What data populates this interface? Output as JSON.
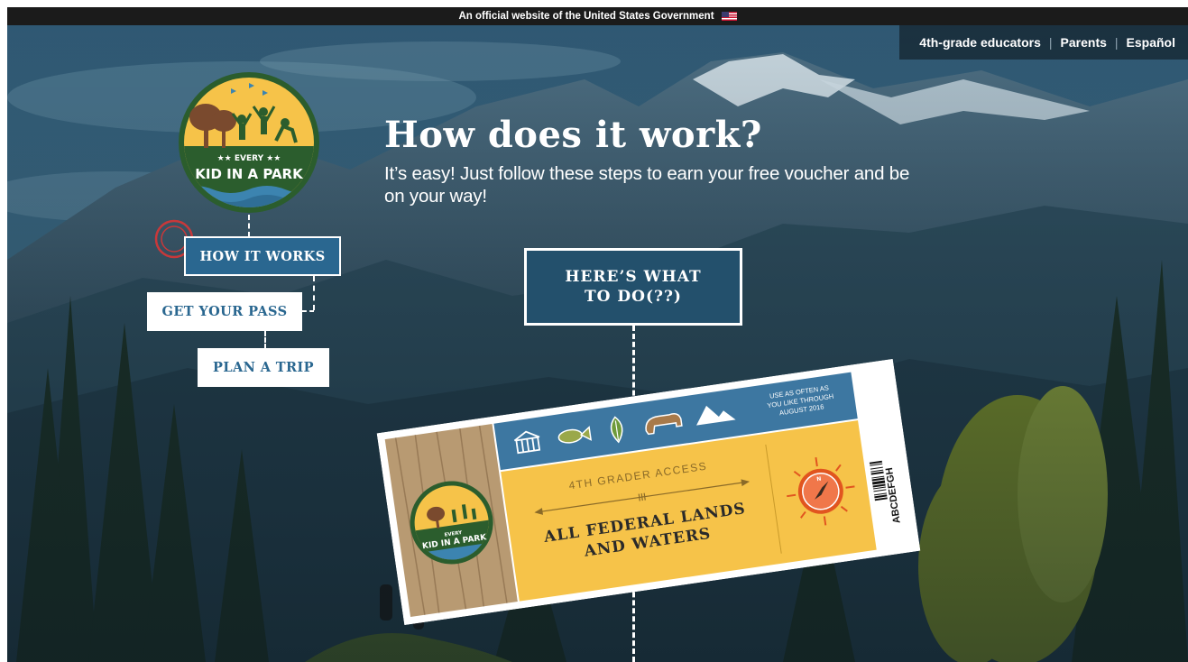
{
  "gov_banner": {
    "text": "An official website of the United States Government",
    "flag_icon": "us-flag-icon"
  },
  "top_nav": {
    "educators": "4th-grade educators",
    "parents": "Parents",
    "language": "Español"
  },
  "logo": {
    "line1": "★★ EVERY ★★",
    "line2": "KID IN A PARK"
  },
  "side_nav": {
    "how_it_works": "HOW IT WORKS",
    "get_your_pass": "GET YOUR PASS",
    "plan_a_trip": "PLAN A TRIP"
  },
  "hero": {
    "title": "How does it work?",
    "subtitle": "It’s easy! Just follow these steps to earn your free voucher and be on your way!"
  },
  "steps_box": {
    "line1": "HERE’S WHAT",
    "line2": "TO DO(??)"
  },
  "ticket": {
    "logo_line1": "EVERY",
    "logo_line2": "KID IN A PARK",
    "validity_line1": "USE AS OFTEN AS",
    "validity_line2": "YOU LIKE THROUGH",
    "validity_line3": "AUGUST 2016",
    "access_label": "4TH GRADER ACCESS",
    "headline_line1": "ALL FEDERAL LANDS",
    "headline_line2": "AND WATERS",
    "barcode_text": "ABCDEFGH",
    "compass_letter": "N",
    "icons": [
      "monument-icon",
      "fish-icon",
      "leaf-icon",
      "bear-icon",
      "mountain-icon"
    ]
  },
  "colors": {
    "brand_blue": "#2a6790",
    "ticket_yellow": "#f6c349",
    "ticket_blue": "#3d77a1",
    "banner_black": "#1b1b1b",
    "logo_green": "#2b5d2d"
  }
}
